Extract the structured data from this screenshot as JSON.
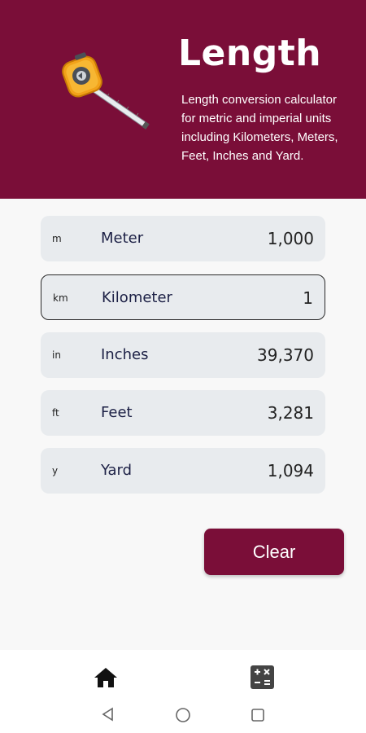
{
  "header": {
    "title": "Length",
    "description": "Length conversion calculator for metric and imperial units including Kilometers, Meters, Feet, Inches and Yard.",
    "background_color": "#7a0e38",
    "icon": "tape-measure-icon"
  },
  "units": [
    {
      "abbr": "m",
      "name": "Meter",
      "value": "1,000",
      "active": false
    },
    {
      "abbr": "km",
      "name": "Kilometer",
      "value": "1",
      "active": true
    },
    {
      "abbr": "in",
      "name": "Inches",
      "value": "39,370",
      "active": false
    },
    {
      "abbr": "ft",
      "name": "Feet",
      "value": "3,281",
      "active": false
    },
    {
      "abbr": "y",
      "name": "Yard",
      "value": "1,094",
      "active": false
    }
  ],
  "clear_button": {
    "label": "Clear"
  },
  "bottom_nav": {
    "items": [
      {
        "icon": "home-icon",
        "selected": true
      },
      {
        "icon": "calculator-icon",
        "selected": false
      }
    ]
  },
  "system_nav": [
    "back-icon",
    "home-circle-icon",
    "recents-icon"
  ]
}
